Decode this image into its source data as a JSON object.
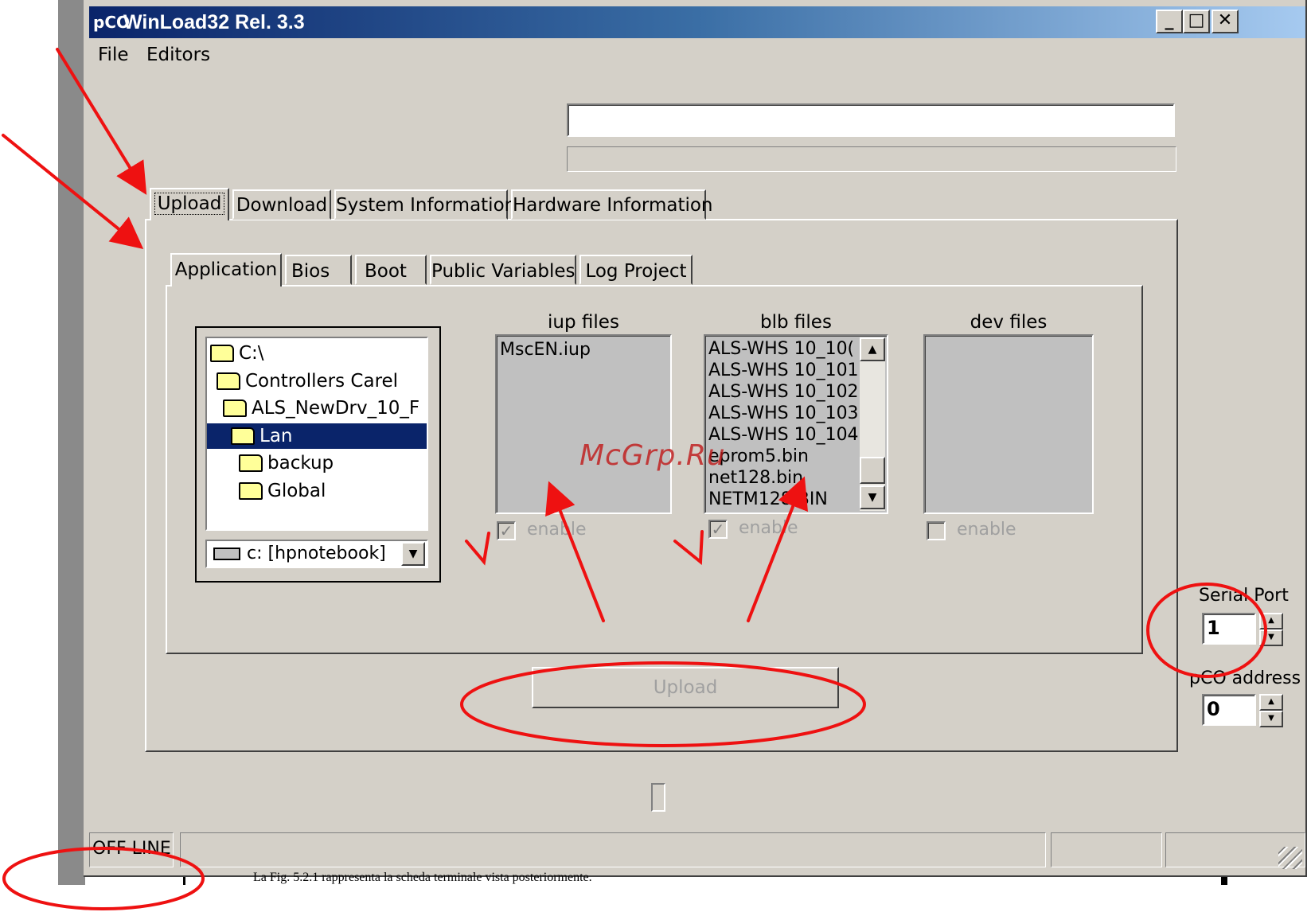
{
  "window": {
    "title": "WinLoad32  Rel. 3.3",
    "app_icon": "pCO",
    "minimize_glyph": "_",
    "maximize_glyph": "□",
    "close_glyph": "✕"
  },
  "menu": {
    "items": [
      {
        "label": "File"
      },
      {
        "label": "Editors"
      }
    ]
  },
  "top_field": {
    "value": ""
  },
  "main_tabs": [
    {
      "label": "Upload",
      "active": true
    },
    {
      "label": "Download",
      "active": false
    },
    {
      "label": "System Information",
      "active": false
    },
    {
      "label": "Hardware Information",
      "active": false
    }
  ],
  "sub_tabs": [
    {
      "label": "Application",
      "active": true
    },
    {
      "label": "Bios",
      "active": false
    },
    {
      "label": "Boot",
      "active": false
    },
    {
      "label": "Public Variables",
      "active": false
    },
    {
      "label": "Log Project",
      "active": false
    }
  ],
  "folder_tree": {
    "items": [
      {
        "label": "C:\\"
      },
      {
        "label": "Controllers Carel"
      },
      {
        "label": "ALS_NewDrv_10_F"
      },
      {
        "label": "Lan"
      },
      {
        "label": "backup"
      },
      {
        "label": "Global"
      }
    ],
    "selected": "Lan",
    "drive": "c: [hpnotebook]"
  },
  "iup_files": {
    "label": "iup files",
    "items": [
      "MscEN.iup"
    ],
    "enable_label": "enable",
    "enabled": true
  },
  "blb_files": {
    "label": "blb files",
    "items": [
      "ALS-WHS 10_10(",
      "ALS-WHS 10_101",
      "ALS-WHS 10_102",
      "ALS-WHS 10_103",
      "ALS-WHS 10_104",
      "eprom5.bin",
      "net128.bin",
      "NETM128.BIN"
    ],
    "enable_label": "enable",
    "enabled": true
  },
  "dev_files": {
    "label": "dev files",
    "items": [],
    "enable_label": "enable",
    "enabled": false
  },
  "upload_button": {
    "label": "Upload"
  },
  "serial_port": {
    "label": "Serial Port",
    "value": "1"
  },
  "pco_address": {
    "label": "pCO address",
    "value": "0"
  },
  "status_bar": {
    "state": "OFF LINE"
  },
  "document_text": "La Fig. 5.2.1 rappresenta la scheda terminale vista posteriormente.",
  "watermark": "McGrp.Ru",
  "colors": {
    "title_bar": "#0a246a",
    "window_bg": "#d4d0c8",
    "selection": "#0a246a",
    "annotation": "#ee1111"
  },
  "icons": [
    "app-icon",
    "folder-icon",
    "open-folder-icon",
    "drive-icon",
    "dropdown-arrow-icon",
    "scroll-up-icon",
    "scroll-down-icon",
    "spin-up-icon",
    "spin-down-icon",
    "resize-grip-icon"
  ]
}
